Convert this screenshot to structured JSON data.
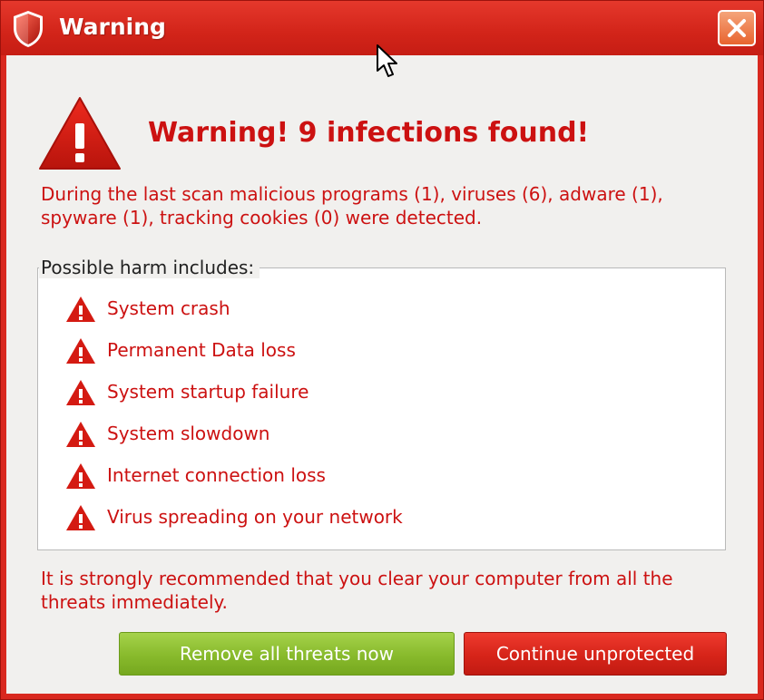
{
  "window": {
    "title": "Warning",
    "title_icon": "shield-icon",
    "close_icon": "close-icon"
  },
  "alert": {
    "icon": "warning-triangle-icon",
    "headline": "Warning! 9 infections found!",
    "description": "During the last scan malicious programs (1), viruses (6), adware (1), spyware (1), tracking cookies (0) were detected."
  },
  "harm": {
    "title": "Possible harm includes:",
    "items": [
      "System crash",
      "Permanent Data loss",
      "System startup failure",
      "System slowdown",
      "Internet connection loss",
      "Virus spreading on your network"
    ]
  },
  "recommendation": "It is strongly recommended that you clear your computer from all the threats immediately.",
  "buttons": {
    "remove": "Remove all threats now",
    "continue": "Continue unprotected"
  },
  "colors": {
    "frame": "#d9281f",
    "text_red": "#cc1111",
    "button_green": "#88ba2c",
    "button_red": "#d62419"
  }
}
